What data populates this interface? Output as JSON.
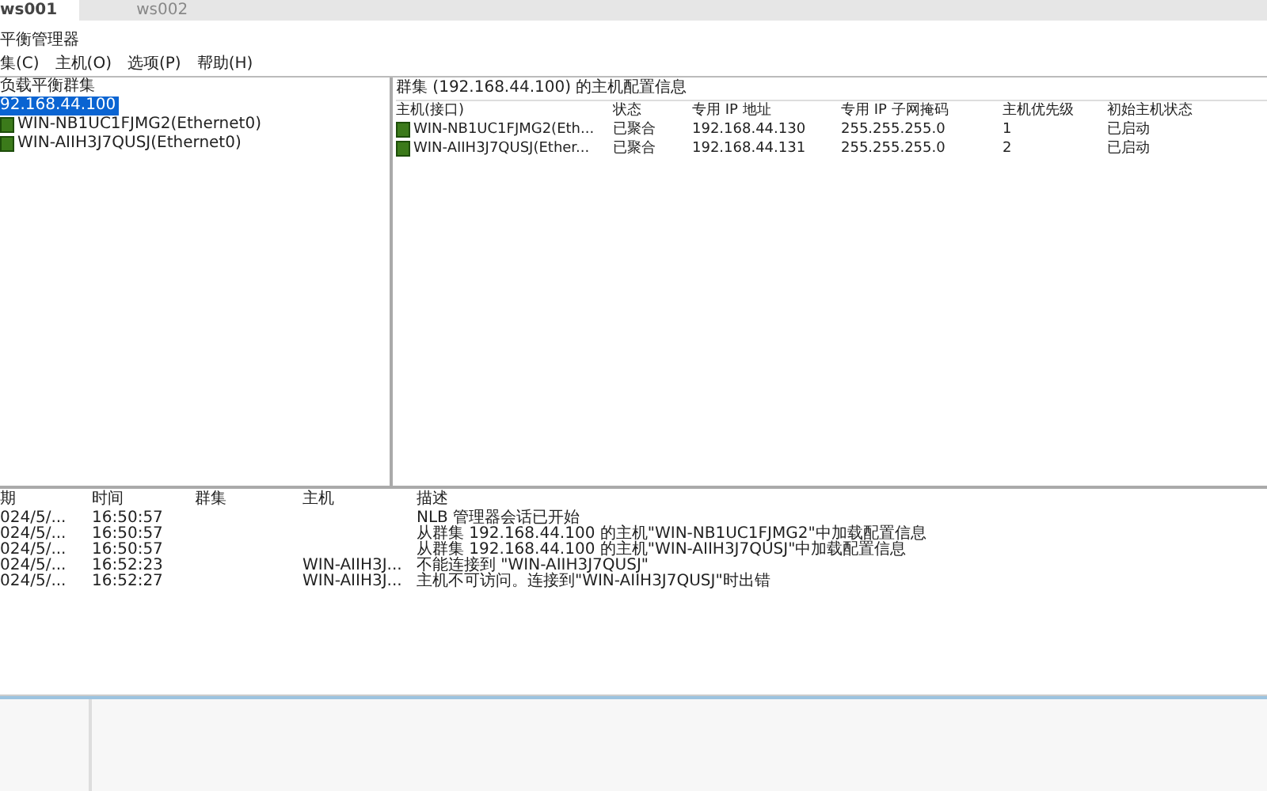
{
  "tabs": [
    {
      "label": "ws001",
      "selected": true
    },
    {
      "label": "ws002",
      "selected": false
    }
  ],
  "window": {
    "title": "平衡管理器"
  },
  "menu": [
    "集(C)",
    "主机(O)",
    "选项(P)",
    "帮助(H)"
  ],
  "tree": {
    "label": "负载平衡群集",
    "children": [
      {
        "label": "92.168.44.100",
        "selected": true,
        "children": [
          {
            "label": "WIN-NB1UC1FJMG2(Ethernet0)",
            "selected": false
          },
          {
            "label": "WIN-AIIH3J7QUSJ(Ethernet0)",
            "selected": false
          }
        ]
      }
    ]
  },
  "host_panel": {
    "title": "群集 (192.168.44.100) 的主机配置信息",
    "columns": [
      "主机(接口)",
      "状态",
      "专用 IP 地址",
      "专用 IP 子网掩码",
      "主机优先级",
      "初始主机状态"
    ],
    "rows": [
      [
        "WIN-NB1UC1FJMG2(Eth...",
        "已聚合",
        "192.168.44.130",
        "255.255.255.0",
        "1",
        "已启动"
      ],
      [
        "WIN-AIIH3J7QUSJ(Ether...",
        "已聚合",
        "192.168.44.131",
        "255.255.255.0",
        "2",
        "已启动"
      ]
    ]
  },
  "log": {
    "columns": [
      "期",
      "时间",
      "群集",
      "主机",
      "描述"
    ],
    "rows": [
      [
        "024/5/...",
        "16:50:57",
        "",
        "",
        "NLB 管理器会话已开始"
      ],
      [
        "024/5/...",
        "16:50:57",
        "",
        "",
        "从群集 192.168.44.100 的主机\"WIN-NB1UC1FJMG2\"中加载配置信息"
      ],
      [
        "024/5/...",
        "16:50:57",
        "",
        "",
        "从群集 192.168.44.100 的主机\"WIN-AIIH3J7QUSJ\"中加载配置信息"
      ],
      [
        "024/5/...",
        "16:52:23",
        "",
        "WIN-AIIH3J...",
        "不能连接到 \"WIN-AIIH3J7QUSJ\""
      ],
      [
        "024/5/...",
        "16:52:27",
        "",
        "WIN-AIIH3J...",
        "主机不可访问。连接到\"WIN-AIIH3J7QUSJ\"时出错"
      ]
    ]
  }
}
